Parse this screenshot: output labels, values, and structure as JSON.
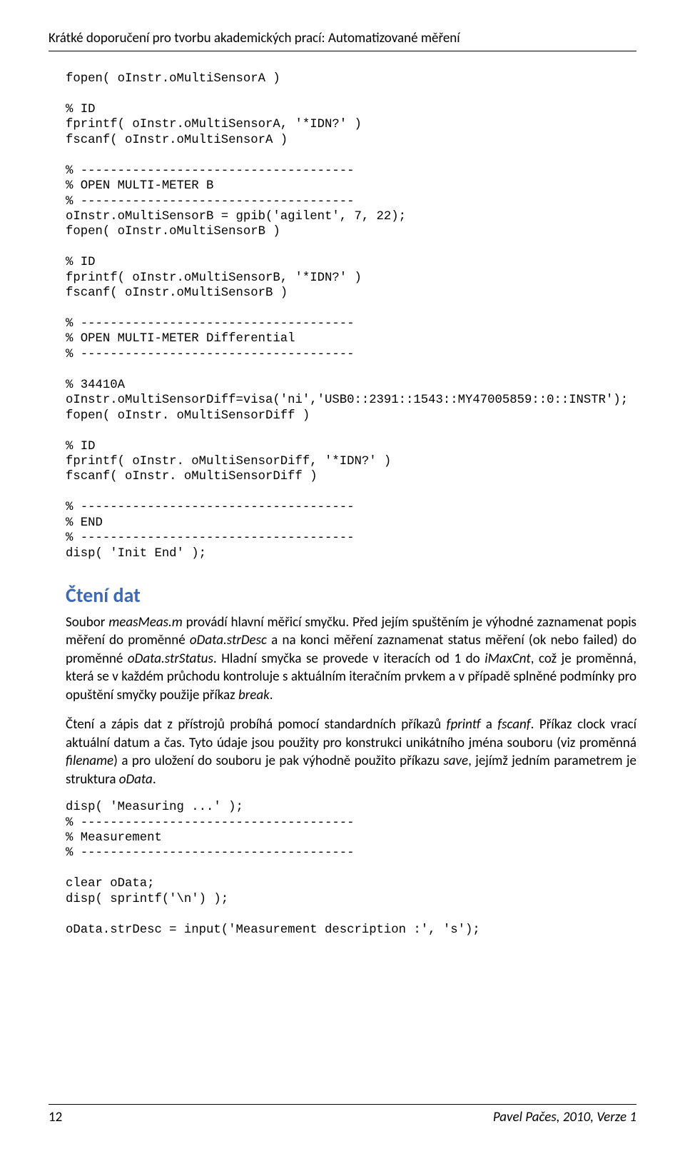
{
  "header": {
    "running_title": "Krátké doporučení pro tvorbu akademických prací: Automatizované měření"
  },
  "code_block_1": "fopen( oInstr.oMultiSensorA )\n\n% ID\nfprintf( oInstr.oMultiSensorA, '*IDN?' )\nfscanf( oInstr.oMultiSensorA )\n\n% -------------------------------------\n% OPEN MULTI-METER B\n% -------------------------------------\noInstr.oMultiSensorB = gpib('agilent', 7, 22);\nfopen( oInstr.oMultiSensorB )\n\n% ID\nfprintf( oInstr.oMultiSensorB, '*IDN?' )\nfscanf( oInstr.oMultiSensorB )\n\n% -------------------------------------\n% OPEN MULTI-METER Differential\n% -------------------------------------\n\n% 34410A\noInstr.oMultiSensorDiff=visa('ni','USB0::2391::1543::MY47005859::0::INSTR');\nfopen( oInstr. oMultiSensorDiff )\n\n% ID\nfprintf( oInstr. oMultiSensorDiff, '*IDN?' )\nfscanf( oInstr. oMultiSensorDiff )\n\n% -------------------------------------\n% END\n% -------------------------------------\ndisp( 'Init End' );",
  "section": {
    "heading": "Čtení dat",
    "p1_a": "Soubor ",
    "p1_b": "measMeas.m",
    "p1_c": " provádí hlavní měřicí smyčku. Před jejím spuštěním je výhodné zaznamenat popis měření do proměnné ",
    "p1_d": "oData.strDesc",
    "p1_e": " a na konci měření zaznamenat status měření (ok nebo failed) do proměnné ",
    "p1_f": "oData.strStatus",
    "p1_g": ". Hladní smyčka se provede v iteracích od 1 do ",
    "p1_h": "iMaxCnt",
    "p1_i": ", což je proměnná, která se v každém průchodu kontroluje s aktuálním iteračním prvkem a v případě splněné podmínky pro opuštění smyčky použije příkaz ",
    "p1_j": "break",
    "p1_k": ".",
    "p2_a": "Čtení a zápis dat z přístrojů probíhá pomocí standardních příkazů ",
    "p2_b": "fprintf",
    "p2_c": " a ",
    "p2_d": "fscanf",
    "p2_e": ". Příkaz clock vrací aktuální datum a čas. Tyto údaje jsou použity pro konstrukci unikátního jména souboru (viz proměnná ",
    "p2_f": "filename",
    "p2_g": ") a pro uložení do souboru je pak výhodně použito příkazu ",
    "p2_h": "save",
    "p2_i": ", jejímž jedním parametrem je struktura ",
    "p2_j": "oData",
    "p2_k": "."
  },
  "code_block_2": "disp( 'Measuring ...' );\n% -------------------------------------\n% Measurement\n% -------------------------------------\n\nclear oData;\ndisp( sprintf('\\n') );\n\noData.strDesc = input('Measurement description :', 's');",
  "footer": {
    "page": "12",
    "author_line": "Pavel Pačes, 2010, Verze 1"
  }
}
